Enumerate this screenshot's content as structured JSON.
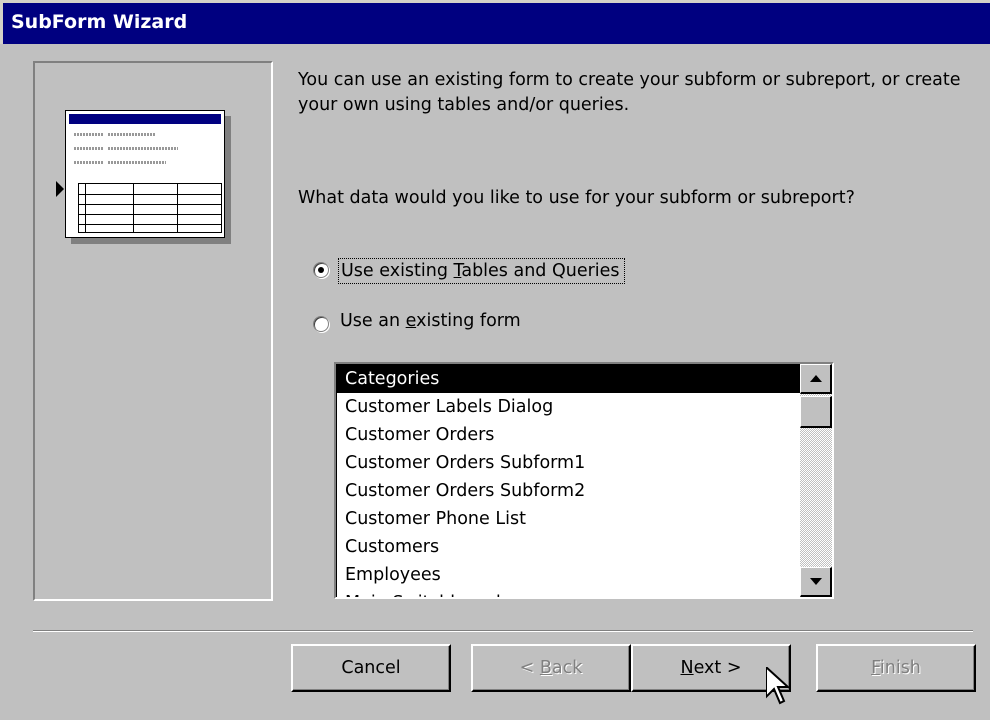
{
  "window": {
    "title": "SubForm Wizard"
  },
  "content": {
    "intro": "You can use an existing form to create your subform or subreport, or create your own using tables and/or queries.",
    "question": "What data would you like to use for your subform or subreport?"
  },
  "options": {
    "opt1_pre": "Use existing ",
    "opt1_key": "T",
    "opt1_post": "ables and Queries",
    "opt2_pre": "Use an ",
    "opt2_key": "e",
    "opt2_post": "xisting form",
    "selected": "Use existing Tables and Queries"
  },
  "forms_list": {
    "items": [
      "Categories",
      "Customer Labels Dialog",
      "Customer Orders",
      "Customer Orders Subform1",
      "Customer Orders Subform2",
      "Customer Phone List",
      "Customers",
      "Employees",
      "Main Switchboard"
    ],
    "selected_index": 0
  },
  "buttons": {
    "cancel": "Cancel",
    "back_pre": "< ",
    "back_key": "B",
    "back_post": "ack",
    "next_key": "N",
    "next_post": "ext >",
    "finish_key": "F",
    "finish_post": "inish"
  },
  "colors": {
    "titlebar": "#000080",
    "face": "#c0c0c0",
    "selection": "#000000"
  }
}
